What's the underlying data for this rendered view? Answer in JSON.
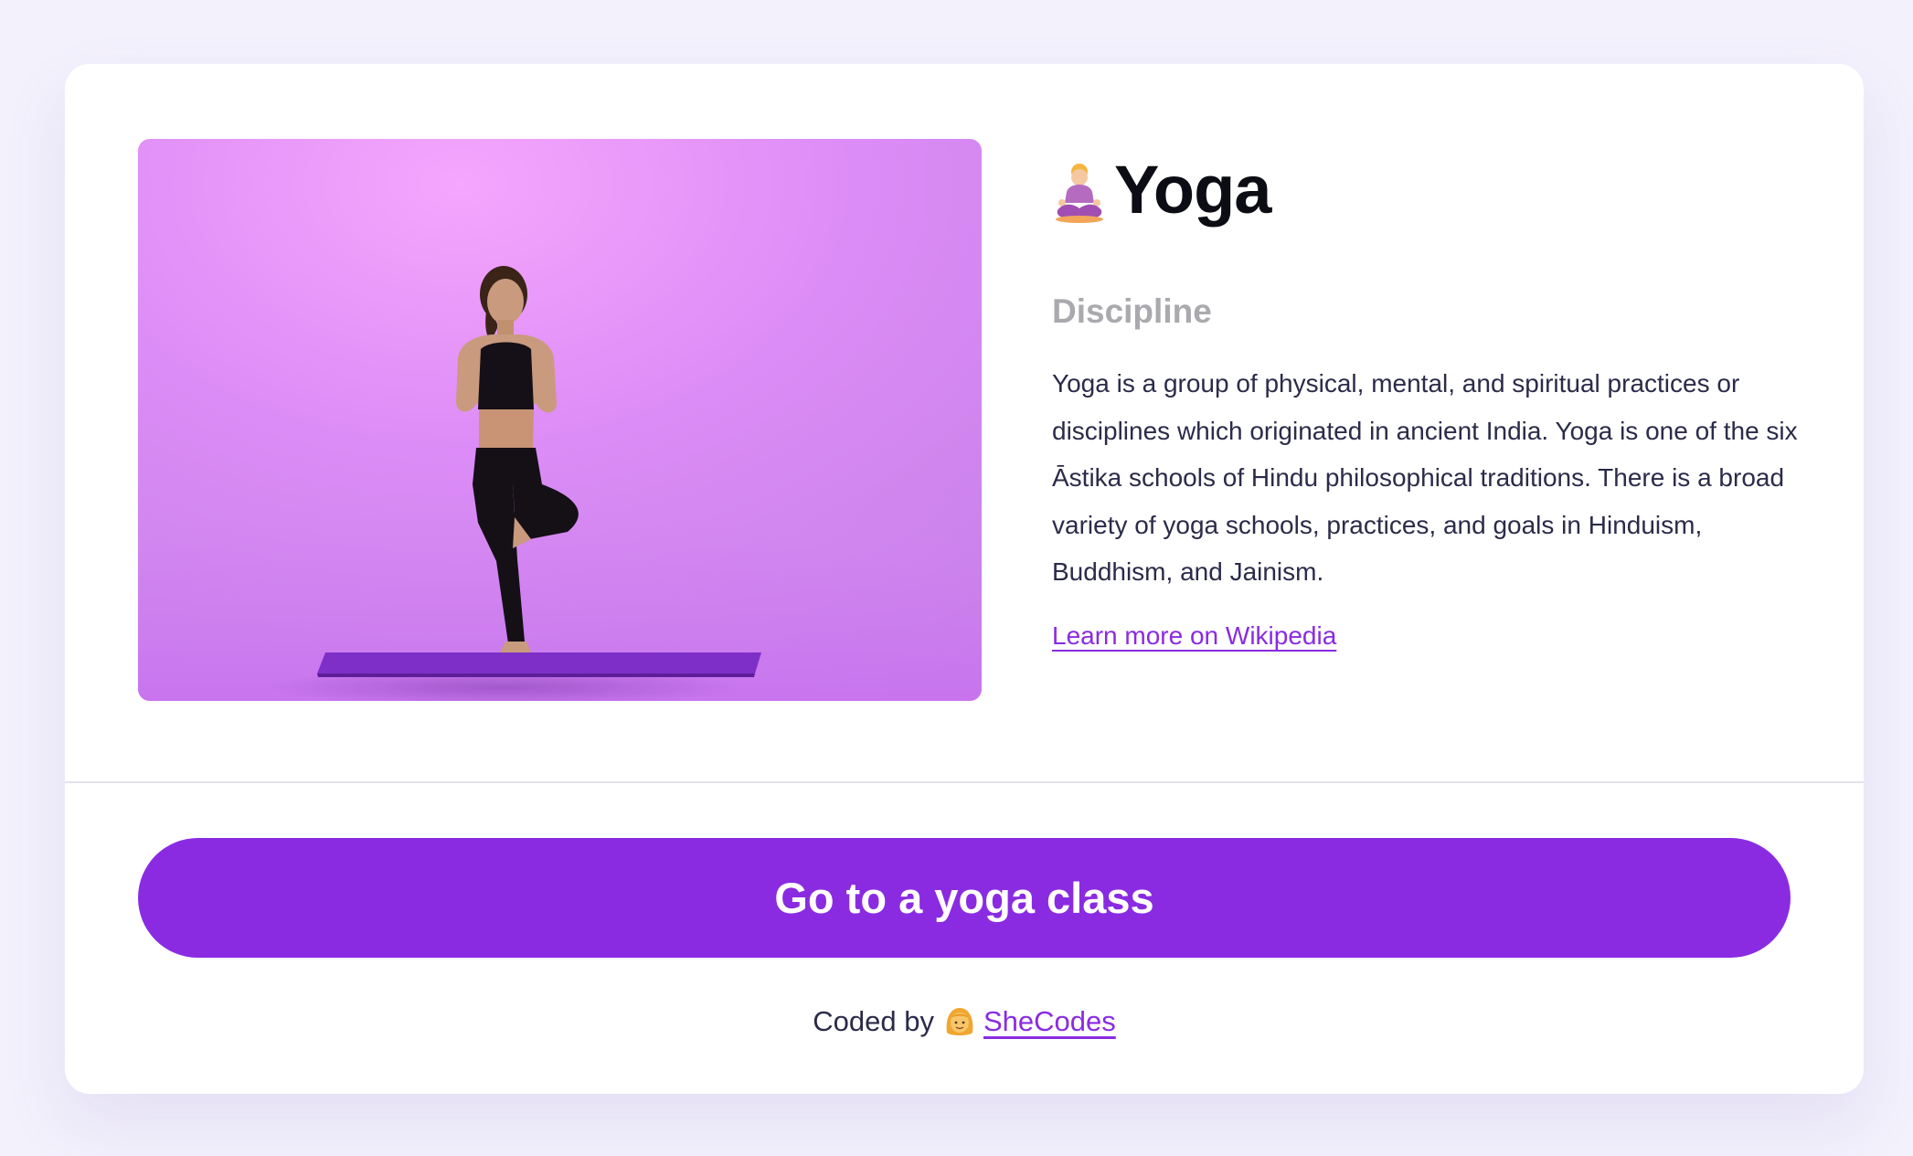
{
  "card": {
    "title": "Yoga",
    "title_icon": "person-in-lotus-position-icon",
    "subtitle": "Discipline",
    "description": "Yoga is a group of physical, mental, and spiritual practices or disciplines which originated in ancient India. Yoga is one of the six Āstika schools of Hindu philosophical traditions. There is a broad variety of yoga schools, practices, and goals in Hinduism, Buddhism, and Jainism.",
    "link_label": "Learn more on Wikipedia",
    "image_icon": "yoga-photo"
  },
  "cta": {
    "label": "Go to a yoga class"
  },
  "footer": {
    "prefix": "Coded by",
    "icon": "woman-icon",
    "link_label": "SheCodes"
  },
  "colors": {
    "accent": "#8a2be2",
    "background": "#f3f1fc",
    "card": "#ffffff",
    "muted": "#a9a9ae",
    "text": "#2b2b4a"
  }
}
